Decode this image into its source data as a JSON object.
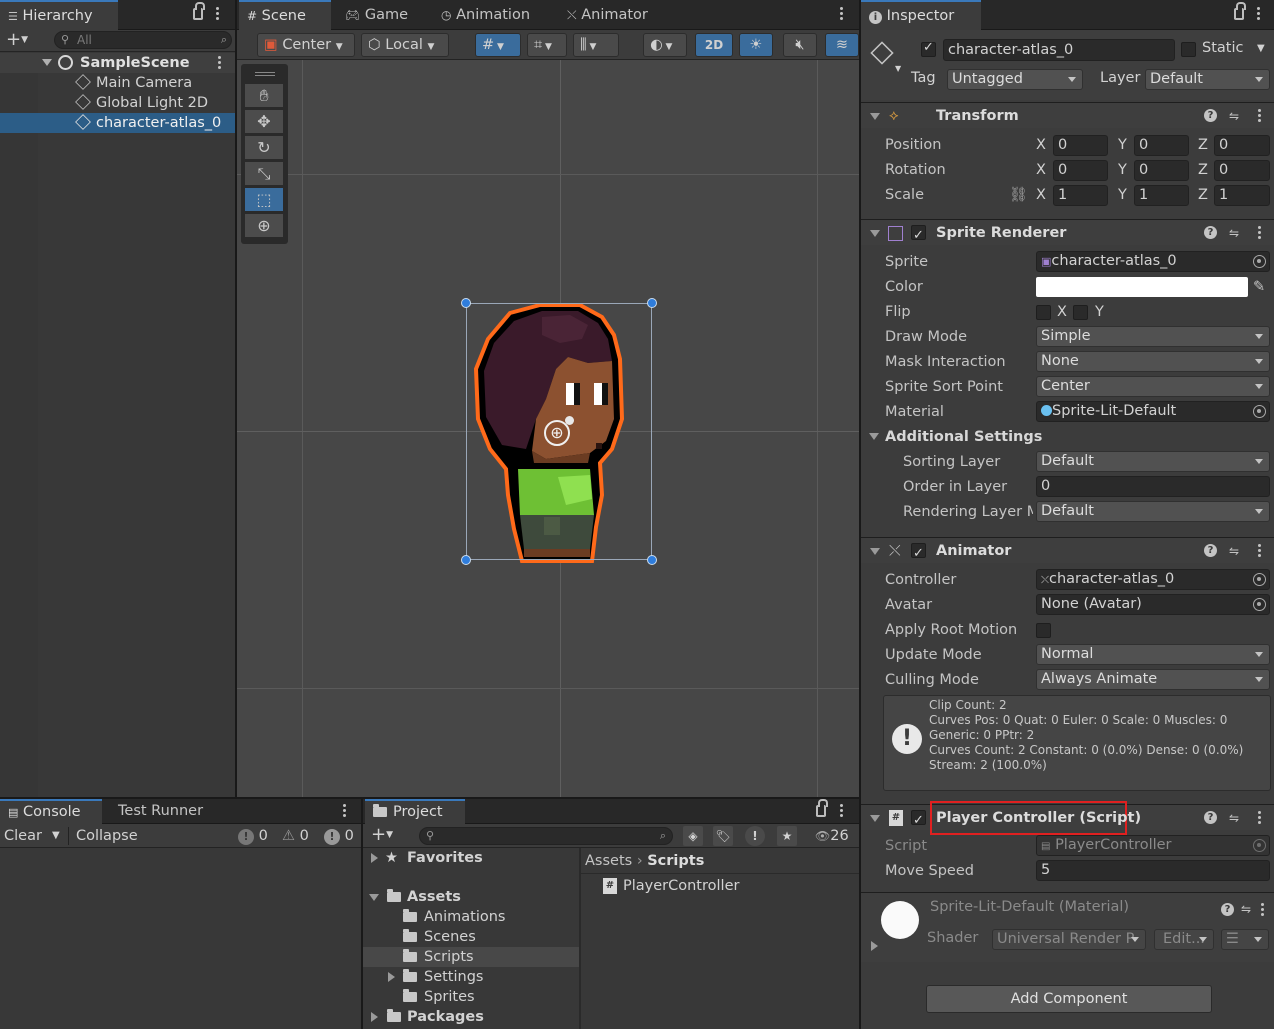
{
  "colors": {
    "accent": "#3a79bb",
    "selection": "#2c5d87",
    "highlight_box": "#e02020",
    "outline": "#ff6a1a",
    "handle": "#2f7ddc"
  },
  "hierarchy": {
    "tab": "Hierarchy",
    "search_placeholder": "All",
    "add": "+",
    "scene": "SampleScene",
    "items": [
      "Main Camera",
      "Global Light 2D",
      "character-atlas_0"
    ],
    "selected": "character-atlas_0"
  },
  "scene_view": {
    "tabs": [
      "Scene",
      "Game",
      "Animation",
      "Animator"
    ],
    "active_tab": "Scene",
    "toolbar": {
      "pivot": "Center",
      "space": "Local",
      "mode_2d": "2D"
    },
    "tools": [
      "hand-tool",
      "move-tool",
      "rotate-tool",
      "scale-tool",
      "rect-tool",
      "transform-tool"
    ],
    "active_tool": "rect-tool"
  },
  "console": {
    "tabs": [
      "Console",
      "Test Runner"
    ],
    "clear": "Clear",
    "collapse": "Collapse",
    "counts": {
      "logs": "0",
      "warnings": "0",
      "errors": "0"
    }
  },
  "project": {
    "tab": "Project",
    "add": "+",
    "hidden_count": "26",
    "tree": {
      "favorites": "Favorites",
      "assets": "Assets",
      "asset_folders": [
        "Animations",
        "Scenes",
        "Scripts",
        "Settings",
        "Sprites"
      ],
      "selected_folder": "Scripts",
      "packages": "Packages"
    },
    "breadcrumb": [
      "Assets",
      "Scripts"
    ],
    "files": [
      "PlayerController"
    ]
  },
  "inspector": {
    "tab": "Inspector",
    "object_name": "character-atlas_0",
    "static_label": "Static",
    "tag_label": "Tag",
    "tag_value": "Untagged",
    "layer_label": "Layer",
    "layer_value": "Default",
    "transform": {
      "title": "Transform",
      "rows": [
        {
          "label": "Position",
          "x": "0",
          "y": "0",
          "z": "0"
        },
        {
          "label": "Rotation",
          "x": "0",
          "y": "0",
          "z": "0"
        },
        {
          "label": "Scale",
          "x": "1",
          "y": "1",
          "z": "1"
        }
      ],
      "axis": {
        "x": "X",
        "y": "Y",
        "z": "Z"
      }
    },
    "sprite_renderer": {
      "title": "Sprite Renderer",
      "sprite_label": "Sprite",
      "sprite_value": "character-atlas_0",
      "color_label": "Color",
      "color_value": "#ffffff",
      "flip_label": "Flip",
      "flip_x": "X",
      "flip_y": "Y",
      "draw_mode_label": "Draw Mode",
      "draw_mode_value": "Simple",
      "mask_label": "Mask Interaction",
      "mask_value": "None",
      "sort_point_label": "Sprite Sort Point",
      "sort_point_value": "Center",
      "material_label": "Material",
      "material_value": "Sprite-Lit-Default",
      "additional_label": "Additional Settings",
      "sorting_layer_label": "Sorting Layer",
      "sorting_layer_value": "Default",
      "order_label": "Order in Layer",
      "order_value": "0",
      "rendering_layer_label": "Rendering Layer M",
      "rendering_layer_value": "Default"
    },
    "animator": {
      "title": "Animator",
      "controller_label": "Controller",
      "controller_value": "character-atlas_0",
      "avatar_label": "Avatar",
      "avatar_value": "None (Avatar)",
      "root_motion_label": "Apply Root Motion",
      "update_label": "Update Mode",
      "update_value": "Normal",
      "culling_label": "Culling Mode",
      "culling_value": "Always Animate",
      "info": [
        "Clip Count: 2",
        "Curves Pos: 0 Quat: 0 Euler: 0 Scale: 0 Muscles: 0",
        "Generic: 0 PPtr: 2",
        "Curves Count: 2 Constant: 0 (0.0%) Dense: 0 (0.0%)",
        "Stream: 2 (100.0%)"
      ]
    },
    "player_controller": {
      "title": "Player Controller (Script)",
      "script_label": "Script",
      "script_value": "PlayerController",
      "speed_label": "Move Speed",
      "speed_value": "5"
    },
    "material": {
      "title": "Sprite-Lit-Default (Material)",
      "shader_label": "Shader",
      "shader_value": "Universal Render P",
      "edit_label": "Edit..."
    },
    "add_component": "Add Component"
  }
}
